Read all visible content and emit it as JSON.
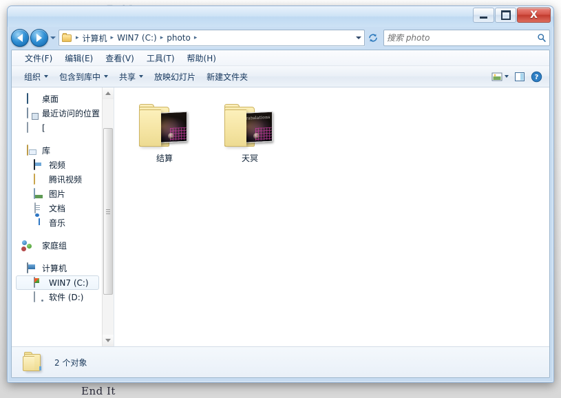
{
  "desktop": {
    "watermark_top": "End It",
    "watermark_bottom": "End It"
  },
  "window": {
    "title": "",
    "controls": {
      "minimize_label": "–",
      "maximize_label": "□",
      "close_label": "X"
    }
  },
  "address_bar": {
    "back_label": "◀",
    "forward_label": "▶",
    "history_caret": "▼",
    "folder_icon": "folder-icon",
    "breadcrumbs": [
      {
        "label": "计算机"
      },
      {
        "label": "WIN7 (C:)"
      },
      {
        "label": "photo"
      }
    ],
    "separator": "▸",
    "dropdown_caret": "▼",
    "refresh_label": "refresh-icon"
  },
  "search": {
    "placeholder": "搜索 photo",
    "value": "",
    "icon": "search-icon"
  },
  "menubar": {
    "items": [
      {
        "label": "文件(F)"
      },
      {
        "label": "编辑(E)"
      },
      {
        "label": "查看(V)"
      },
      {
        "label": "工具(T)"
      },
      {
        "label": "帮助(H)"
      }
    ]
  },
  "commandbar": {
    "items": [
      {
        "label": "组织",
        "has_caret": true
      },
      {
        "label": "包含到库中",
        "has_caret": true
      },
      {
        "label": "共享",
        "has_caret": true
      },
      {
        "label": "放映幻灯片",
        "has_caret": false
      },
      {
        "label": "新建文件夹",
        "has_caret": false
      }
    ],
    "view_icon": "view-layout-icon",
    "view_caret": "▼",
    "preview_pane_icon": "preview-pane-icon",
    "help_icon": "help-icon"
  },
  "navpane": {
    "groups": [
      {
        "rows": [
          {
            "label": "桌面",
            "icon": "desktop-icon",
            "indent": false,
            "selected": false
          },
          {
            "label": "最近访问的位置",
            "icon": "recent-places-icon",
            "indent": false,
            "selected": false
          },
          {
            "label": "[",
            "icon": "shortcut-icon",
            "indent": false,
            "selected": false
          }
        ]
      },
      {
        "rows": [
          {
            "label": "库",
            "icon": "library-icon",
            "indent": false,
            "selected": false
          },
          {
            "label": "视频",
            "icon": "video-icon",
            "indent": true,
            "selected": false
          },
          {
            "label": "腾讯视频",
            "icon": "folder-icon",
            "indent": true,
            "selected": false
          },
          {
            "label": "图片",
            "icon": "pictures-icon",
            "indent": true,
            "selected": false
          },
          {
            "label": "文档",
            "icon": "documents-icon",
            "indent": true,
            "selected": false
          },
          {
            "label": "音乐",
            "icon": "music-icon",
            "indent": true,
            "selected": false
          }
        ]
      },
      {
        "rows": [
          {
            "label": "家庭组",
            "icon": "homegroup-icon",
            "indent": false,
            "selected": false
          }
        ]
      },
      {
        "rows": [
          {
            "label": "计算机",
            "icon": "computer-icon",
            "indent": false,
            "selected": false
          },
          {
            "label": "WIN7 (C:)",
            "icon": "windows-drive-icon",
            "indent": true,
            "selected": true
          },
          {
            "label": "软件 (D:)",
            "icon": "drive-icon",
            "indent": true,
            "selected": false
          }
        ]
      }
    ],
    "scrollbar": {
      "up_arrow": "▲",
      "down_arrow": "▼"
    }
  },
  "content": {
    "items": [
      {
        "label": "结算",
        "icon": "folder-thumbnail-icon",
        "thumb_caption": ""
      },
      {
        "label": "天冥",
        "icon": "folder-thumbnail-icon",
        "thumb_caption": "ngratulations"
      }
    ]
  },
  "statusbar": {
    "icon": "folder-icon",
    "text": "2 个对象"
  },
  "colors": {
    "accent": "#2f8fd4",
    "close_button": "#c23b2e",
    "folder_yellow": "#f4e3a0",
    "text_primary": "#0f2236",
    "selection": "#eef5fc"
  }
}
